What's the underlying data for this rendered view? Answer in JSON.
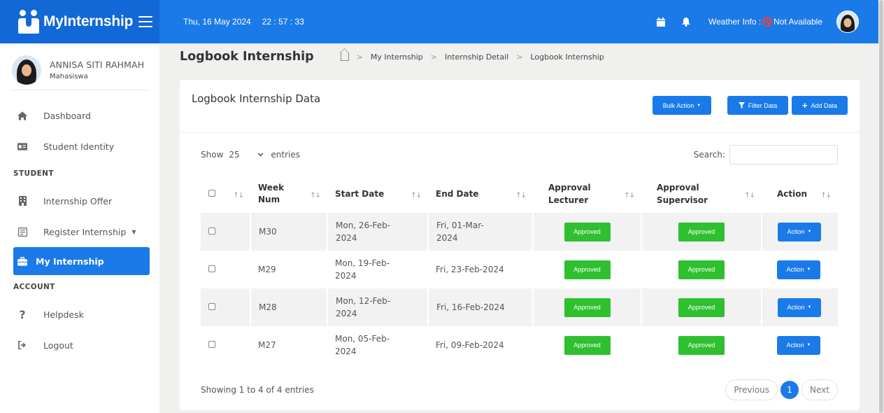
{
  "app": {
    "brand": "MyInternship"
  },
  "topbar": {
    "date": "Thu, 16 May 2024",
    "time": "22 : 57 : 33",
    "weather_label": "Weather Info :",
    "weather_value": "Not Available"
  },
  "user": {
    "name": "ANNISA SITI RAHMAH",
    "role": "Mahasiswa"
  },
  "sidebar": {
    "items": [
      {
        "label": "Dashboard",
        "icon": "home-icon"
      },
      {
        "label": "Student Identity",
        "icon": "id-card-icon"
      }
    ],
    "section_student": "STUDENT",
    "student_items": [
      {
        "label": "Internship Offer",
        "icon": "building-icon"
      },
      {
        "label": "Register Internship",
        "icon": "form-icon"
      },
      {
        "label": "My Internship",
        "icon": "briefcase-icon"
      }
    ],
    "section_account": "ACCOUNT",
    "account_items": [
      {
        "label": "Helpdesk",
        "icon": "question-icon"
      },
      {
        "label": "Logout",
        "icon": "logout-icon"
      }
    ]
  },
  "page": {
    "title": "Logbook Internship",
    "breadcrumb": [
      "My Internship",
      "Internship Detail",
      "Logbook Internship"
    ]
  },
  "card": {
    "title": "Logbook Internship Data",
    "bulk_action": "Bulk Action",
    "filter_data": "Filter Data",
    "add_data": "Add Data",
    "show_label": "Show",
    "entries_value": "25",
    "entries_label": "entries",
    "search_label": "Search:",
    "search_value": ""
  },
  "table": {
    "columns": [
      "Week Num",
      "Start Date",
      "End Date",
      "Approval Lecturer",
      "Approval Supervisor",
      "Action"
    ],
    "rows": [
      {
        "week": "M30",
        "start": "Mon, 26-Feb-2024",
        "end": "Fri, 01-Mar-2024",
        "lecturer": "Approved",
        "supervisor": "Approved",
        "action": "Action"
      },
      {
        "week": "M29",
        "start": "Mon, 19-Feb-2024",
        "end": "Fri, 23-Feb-2024",
        "lecturer": "Approved",
        "supervisor": "Approved",
        "action": "Action"
      },
      {
        "week": "M28",
        "start": "Mon, 12-Feb-2024",
        "end": "Fri, 16-Feb-2024",
        "lecturer": "Approved",
        "supervisor": "Approved",
        "action": "Action"
      },
      {
        "week": "M27",
        "start": "Mon, 05-Feb-2024",
        "end": "Fri, 09-Feb-2024",
        "lecturer": "Approved",
        "supervisor": "Approved",
        "action": "Action"
      }
    ]
  },
  "footer": {
    "info": "Showing 1 to 4 of 4 entries",
    "previous": "Previous",
    "current_page": "1",
    "next": "Next"
  },
  "colors": {
    "primary": "#1a7ae8",
    "approved": "#2fc02f",
    "brand_bg": "#1168d6"
  }
}
